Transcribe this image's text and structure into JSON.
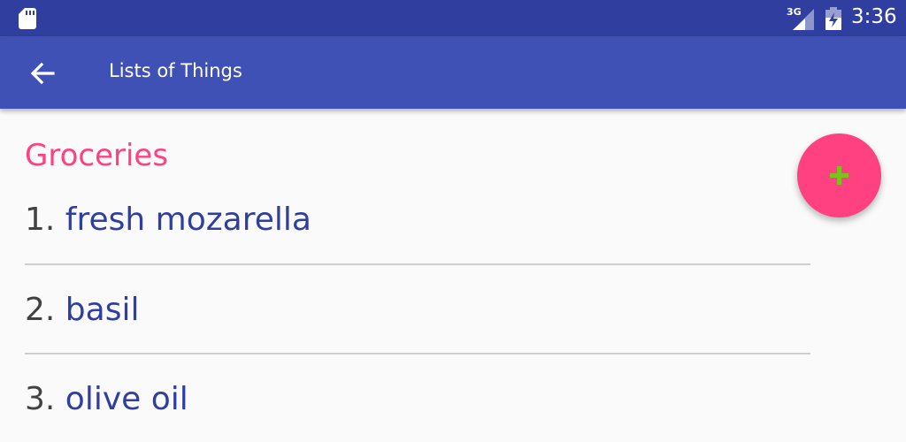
{
  "status_bar": {
    "network_label": "3G",
    "time": "3:36",
    "icons": [
      "sd-card-icon",
      "signal-icon",
      "battery-icon"
    ]
  },
  "toolbar": {
    "title": "Lists of Things",
    "back_icon": "arrow-back-icon"
  },
  "list": {
    "title": "Groceries",
    "items": [
      {
        "number": "1. ",
        "text": "fresh mozarella"
      },
      {
        "number": "2. ",
        "text": "basil"
      },
      {
        "number": "3. ",
        "text": "olive oil"
      }
    ]
  },
  "fab": {
    "icon": "plus-icon"
  },
  "colors": {
    "status_bar": "#303f9f",
    "toolbar": "#3f51b5",
    "accent": "#ff4081",
    "item_text": "#303f9f",
    "fab_icon": "#7cc21f"
  }
}
